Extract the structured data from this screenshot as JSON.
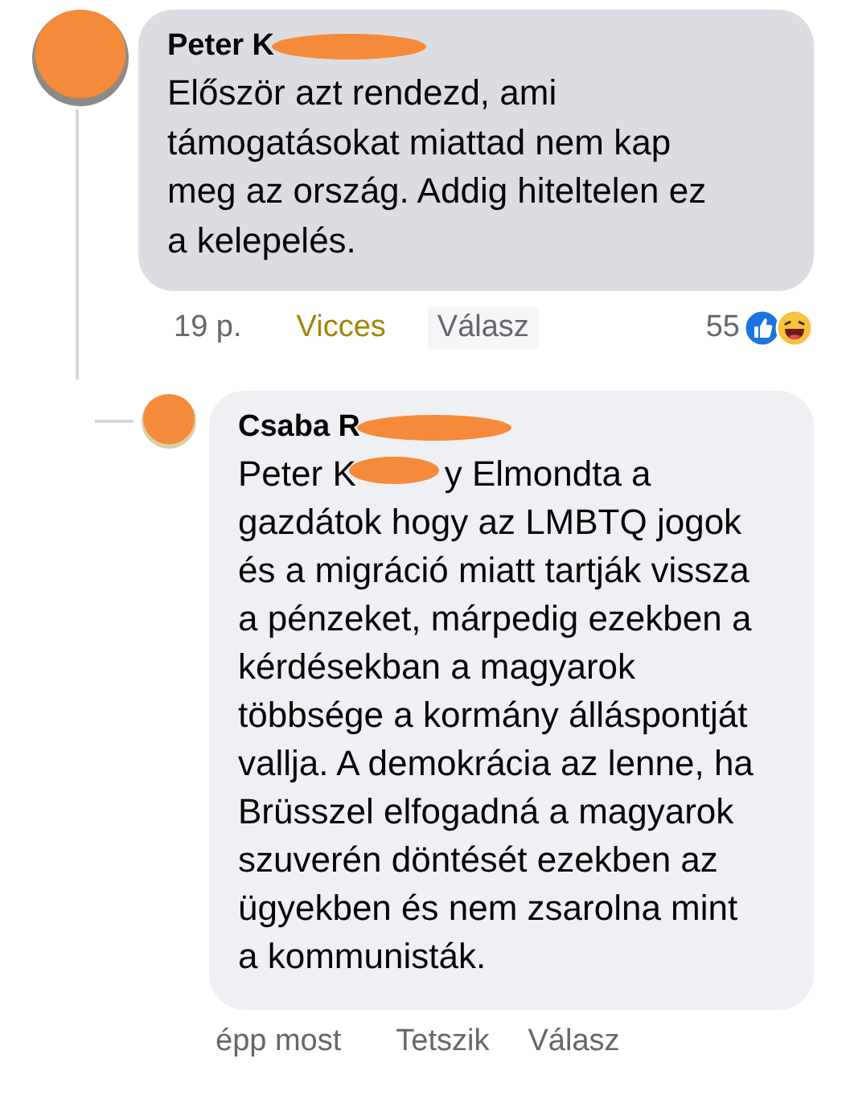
{
  "comments": [
    {
      "author": "Peter K",
      "body_after": "Először azt rendezd, ami támogatásokat miattad nem kap meg az ország. Addig hiteltelen ez a kelepelés.",
      "time": "19 p.",
      "react": {
        "label": "Vicces",
        "selected": true
      },
      "reply": "Válasz",
      "reaction_count": "55",
      "reply_level": false
    },
    {
      "author": "Csaba R",
      "body_before": "Peter K",
      "body_after": "y Elmondta a gazdátok hogy az LMBTQ jogok és a migráció miatt tartják vissza a pénzeket, márpedig ezekben a kérdésekban a magyarok többsége a kormány álláspontját vallja. A demokrácia az lenne, ha Brüsszel elfogadná a magyarok szuverén döntését ezekben az ügyekben és nem zsarolna mint a kommunisták.",
      "time": "épp most",
      "react": {
        "label": "Tetszik",
        "selected": false
      },
      "reply": "Válasz",
      "reply_level": true
    }
  ]
}
